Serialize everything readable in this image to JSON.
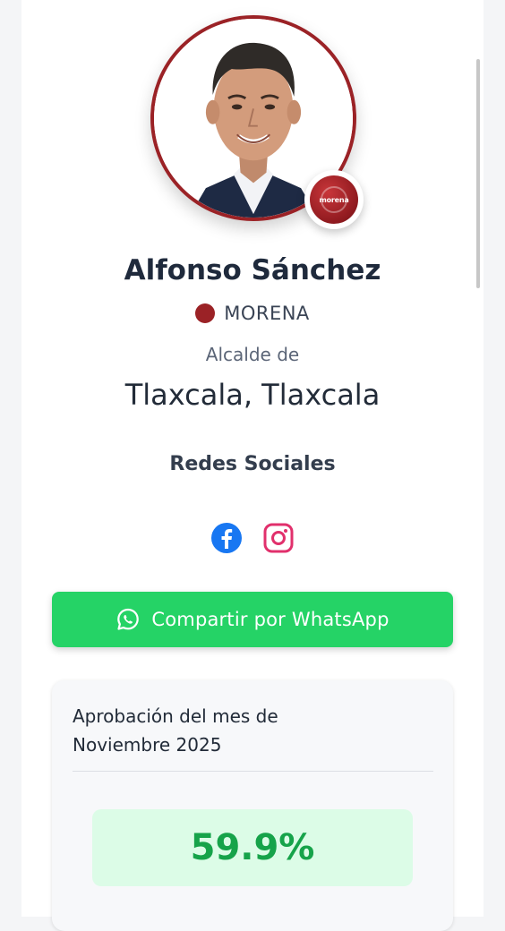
{
  "profile": {
    "name": "Alfonso Sánchez",
    "party": "MORENA",
    "party_badge_text": "morena",
    "party_color": "#9b2226",
    "role": "Alcalde de",
    "location": "Tlaxcala, Tlaxcala"
  },
  "social": {
    "title": "Redes Sociales",
    "icons": [
      "facebook-icon",
      "instagram-icon"
    ]
  },
  "share": {
    "label": "Compartir por WhatsApp",
    "icon": "whatsapp-icon",
    "color": "#25d366"
  },
  "approval": {
    "title_line1": "Aprobación del mes de",
    "title_line2": "Noviembre 2025",
    "value": "59.9%",
    "value_color": "#16a34a"
  }
}
